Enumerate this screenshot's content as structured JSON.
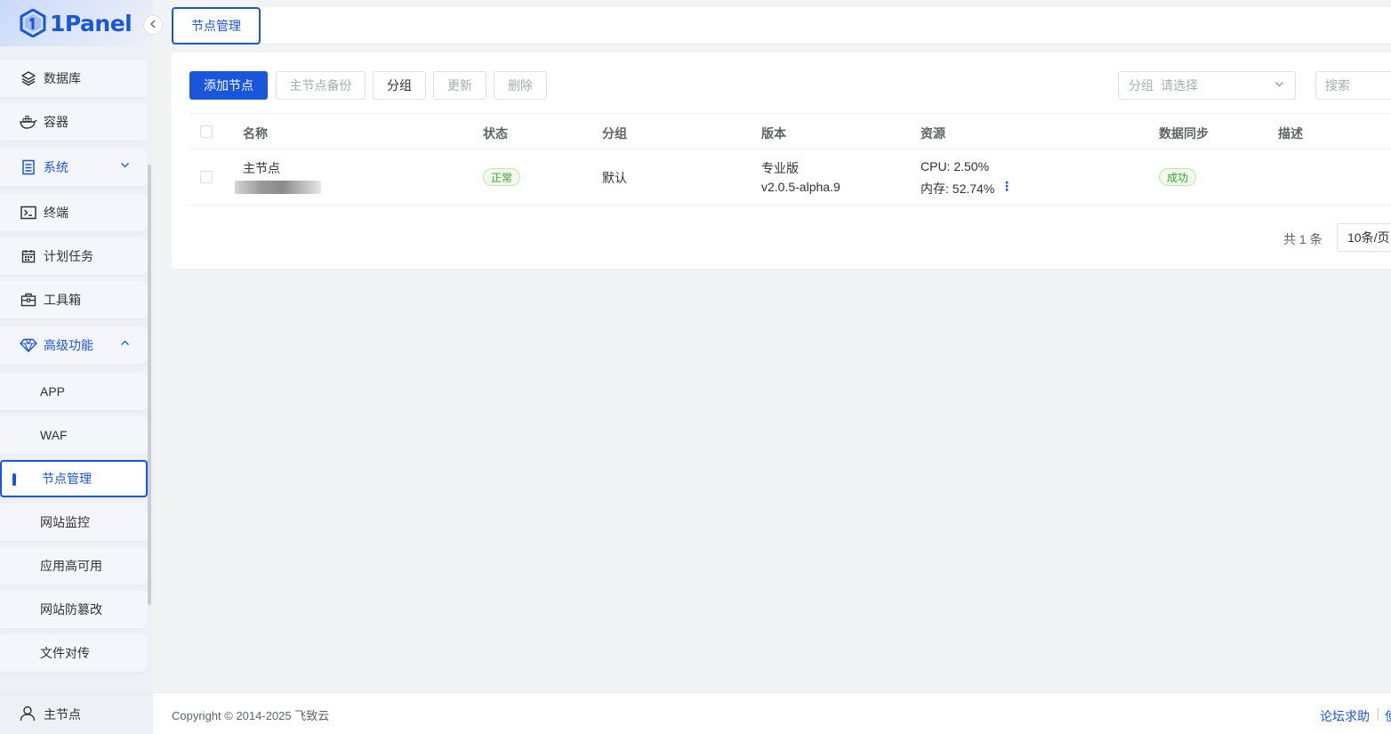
{
  "app": {
    "logo_text": "1Panel",
    "collapse_icon": "chevron-left-icon"
  },
  "sidebar": {
    "items": [
      {
        "label": "数据库",
        "icon": "layers-icon"
      },
      {
        "label": "容器",
        "icon": "docker-icon"
      },
      {
        "label": "系统",
        "icon": "server-icon",
        "expanded": false
      },
      {
        "label": "终端",
        "icon": "terminal-icon"
      },
      {
        "label": "计划任务",
        "icon": "calendar-icon"
      },
      {
        "label": "工具箱",
        "icon": "toolbox-icon"
      },
      {
        "label": "高级功能",
        "icon": "diamond-icon",
        "expanded": true
      }
    ],
    "sub_items": [
      {
        "label": "APP"
      },
      {
        "label": "WAF"
      },
      {
        "label": "节点管理",
        "active": true
      },
      {
        "label": "网站监控"
      },
      {
        "label": "应用高可用"
      },
      {
        "label": "网站防篡改"
      },
      {
        "label": "文件对传"
      }
    ],
    "bottom_label": "主节点"
  },
  "tabs": {
    "active_label": "节点管理"
  },
  "toolbar": {
    "add_node": "添加节点",
    "master_backup": "主节点备份",
    "group": "分组",
    "update": "更新",
    "delete": "删除",
    "group_filter_label": "分组",
    "group_filter_placeholder": "请选择",
    "search_placeholder": "搜索"
  },
  "table": {
    "columns": [
      "名称",
      "状态",
      "分组",
      "版本",
      "资源",
      "数据同步",
      "描述"
    ],
    "rows": [
      {
        "name": "主节点",
        "status": "正常",
        "group": "默认",
        "edition": "专业版",
        "version": "v2.0.5-alpha.9",
        "cpu": "CPU: 2.50%",
        "memory": "内存: 52.74%",
        "sync": "成功",
        "description": ""
      }
    ]
  },
  "pagination": {
    "total": "共 1 条",
    "page_size": "10条/页"
  },
  "footer": {
    "copyright": "Copyright © 2014-2025 飞致云",
    "forum": "论坛求助",
    "more": "使"
  },
  "colors": {
    "primary": "#1a56db",
    "success": "#3aa52f",
    "sidebar_bg": "#eef0f6"
  }
}
